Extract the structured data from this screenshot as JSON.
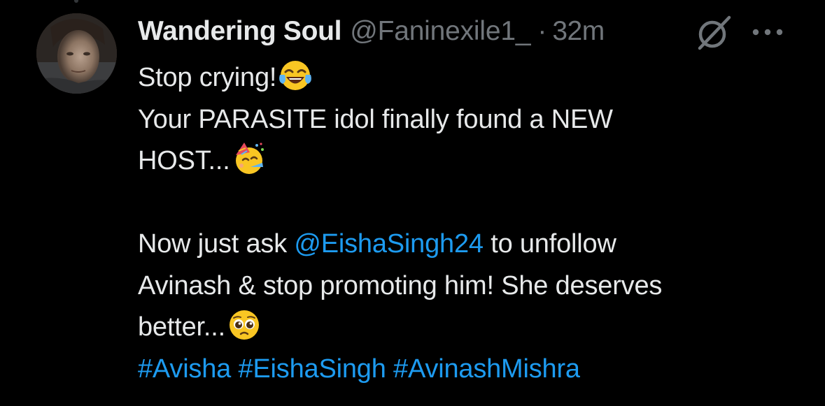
{
  "tweet": {
    "author": {
      "display_name": "Wandering Soul",
      "handle": "@Faninexile1_"
    },
    "separator": "·",
    "timestamp": "32m",
    "icons": {
      "avatar": "avatar",
      "grok": "grok-icon",
      "more": "more-options-icon"
    },
    "body": {
      "line1": "Stop crying!",
      "line1_emoji": "face-with-tears-of-joy",
      "line2": "Your PARASITE idol finally found a NEW",
      "line3": "HOST...",
      "line3_emoji": "partying-face",
      "line4_prefix": "Now just ask ",
      "line4_mention": "@EishaSingh24",
      "line4_suffix": " to unfollow",
      "line5": "Avinash & stop promoting him! She deserves",
      "line6": "better...",
      "line6_emoji": "pleading-face",
      "hashtags": [
        "#Avisha",
        "#EishaSingh",
        "#AvinashMishra"
      ]
    },
    "colors": {
      "background": "#000000",
      "text": "#e7e9ea",
      "secondary": "#71767b",
      "link": "#1d9bf0"
    }
  }
}
